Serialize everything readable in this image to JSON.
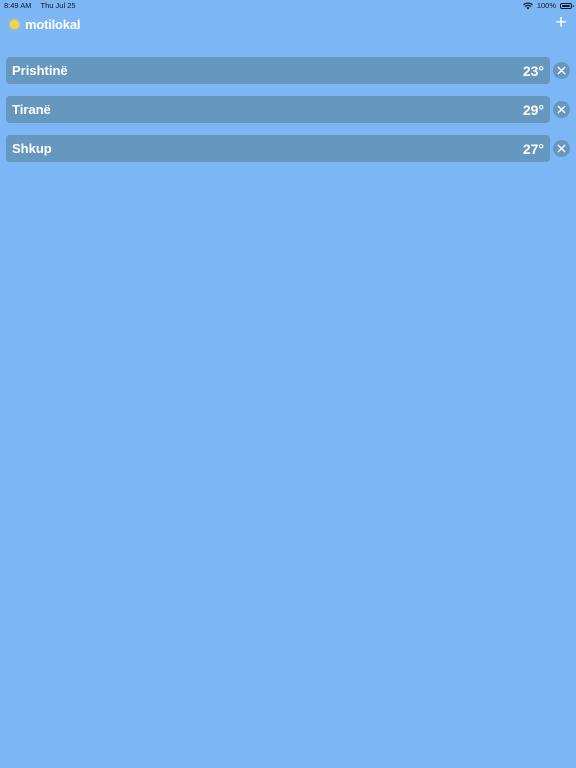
{
  "status_bar": {
    "time": "8:49 AM",
    "date": "Thu Jul 25",
    "battery": "100%"
  },
  "header": {
    "title": "motilokal",
    "add_label": "+"
  },
  "cities": [
    {
      "name": "Prishtinë",
      "temp": "23°"
    },
    {
      "name": "Tiranë",
      "temp": "29°"
    },
    {
      "name": "Shkup",
      "temp": "27°"
    }
  ],
  "colors": {
    "background": "#7db6f5",
    "card": "#6697bf",
    "sun": "#f3d34a"
  },
  "icons": {
    "logo": "sun-icon",
    "remove": "close-icon",
    "add": "plus-icon"
  }
}
